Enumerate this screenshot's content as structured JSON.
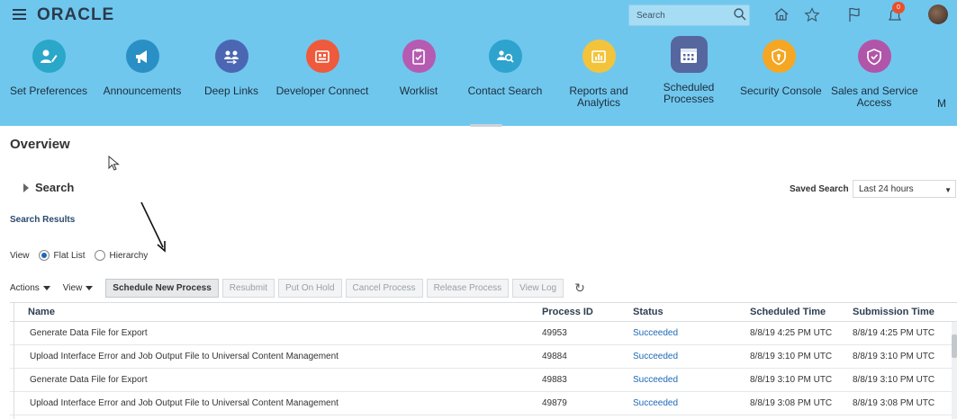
{
  "header": {
    "logo": "ORACLE",
    "search_placeholder": "Search",
    "notification_count": "0"
  },
  "springboard": {
    "tiles": [
      {
        "label": "Set Preferences",
        "color": "#2aa7c9",
        "icon": "user-edit-icon"
      },
      {
        "label": "Announcements",
        "color": "#2a8fc4",
        "icon": "megaphone-icon"
      },
      {
        "label": "Deep Links",
        "color": "#4b67b3",
        "icon": "people-link-icon"
      },
      {
        "label": "Developer Connect",
        "color": "#ef5a3c",
        "icon": "connect-icon"
      },
      {
        "label": "Worklist",
        "color": "#b65bb2",
        "icon": "clipboard-icon"
      },
      {
        "label": "Contact Search",
        "color": "#2ea3cd",
        "icon": "contact-search-icon"
      },
      {
        "label": "Reports and",
        "label2": "Analytics",
        "color": "#f3c43b",
        "icon": "chart-icon"
      },
      {
        "label": "Scheduled",
        "label2": "Processes",
        "color": "#56679f",
        "icon": "calendar-icon"
      },
      {
        "label": "Security Console",
        "color": "#f5a623",
        "icon": "shield-icon"
      },
      {
        "label": "Sales and Service",
        "label2": "Access",
        "color": "#b155a9",
        "icon": "shield-check-icon"
      },
      {
        "label": "M",
        "color": "#6fc7ee",
        "icon": ""
      }
    ]
  },
  "page": {
    "title": "Overview",
    "search_label": "Search",
    "saved_search_label": "Saved Search",
    "saved_search_value": "Last 24 hours",
    "results_title": "Search Results",
    "view_label": "View",
    "view_options": [
      "Flat List",
      "Hierarchy"
    ],
    "view_selected": "Flat List"
  },
  "toolbar": {
    "actions_label": "Actions",
    "view_label": "View",
    "schedule_new_process": "Schedule New Process",
    "resubmit": "Resubmit",
    "put_on_hold": "Put On Hold",
    "cancel_process": "Cancel Process",
    "release_process": "Release Process",
    "view_log": "View Log",
    "refresh_icon": "↻"
  },
  "table": {
    "columns": [
      "Name",
      "Process ID",
      "Status",
      "Scheduled Time",
      "Submission Time"
    ],
    "rows": [
      {
        "name": "Generate Data File for Export",
        "process_id": "49953",
        "status": "Succeeded",
        "scheduled": "8/8/19 4:25 PM UTC",
        "submitted": "8/8/19 4:25 PM UTC"
      },
      {
        "name": "Upload Interface Error and Job Output File to Universal Content Management",
        "process_id": "49884",
        "status": "Succeeded",
        "scheduled": "8/8/19 3:10 PM UTC",
        "submitted": "8/8/19 3:10 PM UTC"
      },
      {
        "name": "Generate Data File for Export",
        "process_id": "49883",
        "status": "Succeeded",
        "scheduled": "8/8/19 3:10 PM UTC",
        "submitted": "8/8/19 3:10 PM UTC"
      },
      {
        "name": "Upload Interface Error and Job Output File to Universal Content Management",
        "process_id": "49879",
        "status": "Succeeded",
        "scheduled": "8/8/19 3:08 PM UTC",
        "submitted": "8/8/19 3:08 PM UTC"
      }
    ]
  }
}
